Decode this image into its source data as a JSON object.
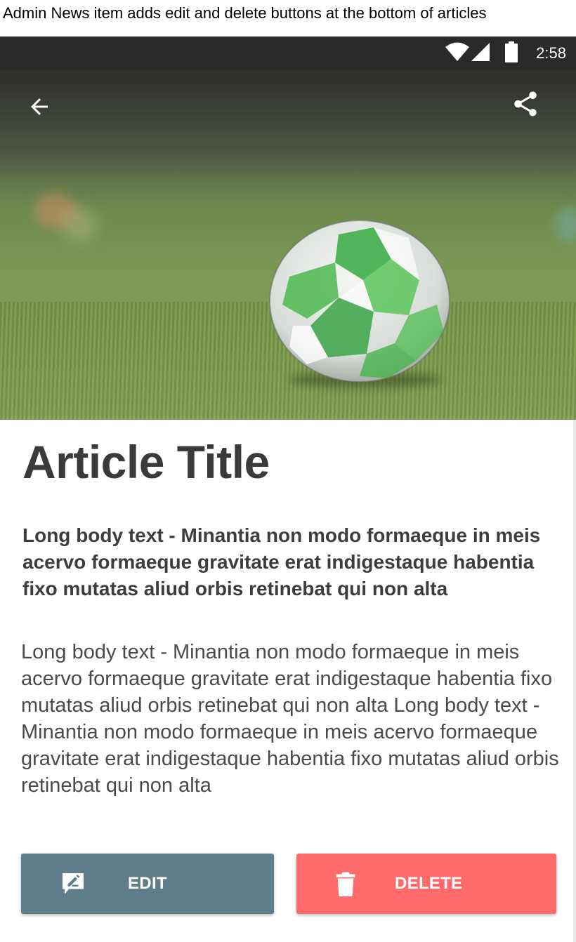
{
  "caption": "Admin News item adds edit and delete buttons at the bottom of articles",
  "status_bar": {
    "time": "2:58",
    "icons": [
      "wifi-icon",
      "cell-signal-icon",
      "battery-icon"
    ]
  },
  "app_bar": {
    "back_icon": "arrow-back-icon",
    "share_icon": "share-icon"
  },
  "hero_image": {
    "subject": "soccer ball on grass"
  },
  "article": {
    "title": "Article Title",
    "lead": "Long body text - Minantia non modo formaeque in meis acervo formaeque gravitate erat indigestaque habentia fixo mutatas aliud orbis retinebat qui non alta",
    "body": "Long body text - Minantia non modo formaeque in meis acervo formaeque gravitate erat indigestaque habentia fixo mutatas aliud orbis retinebat qui non alta Long body text - Minantia non modo formaeque in meis acervo formaeque gravitate erat indigestaque habentia fixo mutatas aliud orbis retinebat qui non alta"
  },
  "actions": {
    "edit": {
      "label": "EDIT",
      "icon": "edit-icon",
      "color": "#607d8b"
    },
    "delete": {
      "label": "DELETE",
      "icon": "trash-icon",
      "color": "#ff6b6b"
    }
  }
}
